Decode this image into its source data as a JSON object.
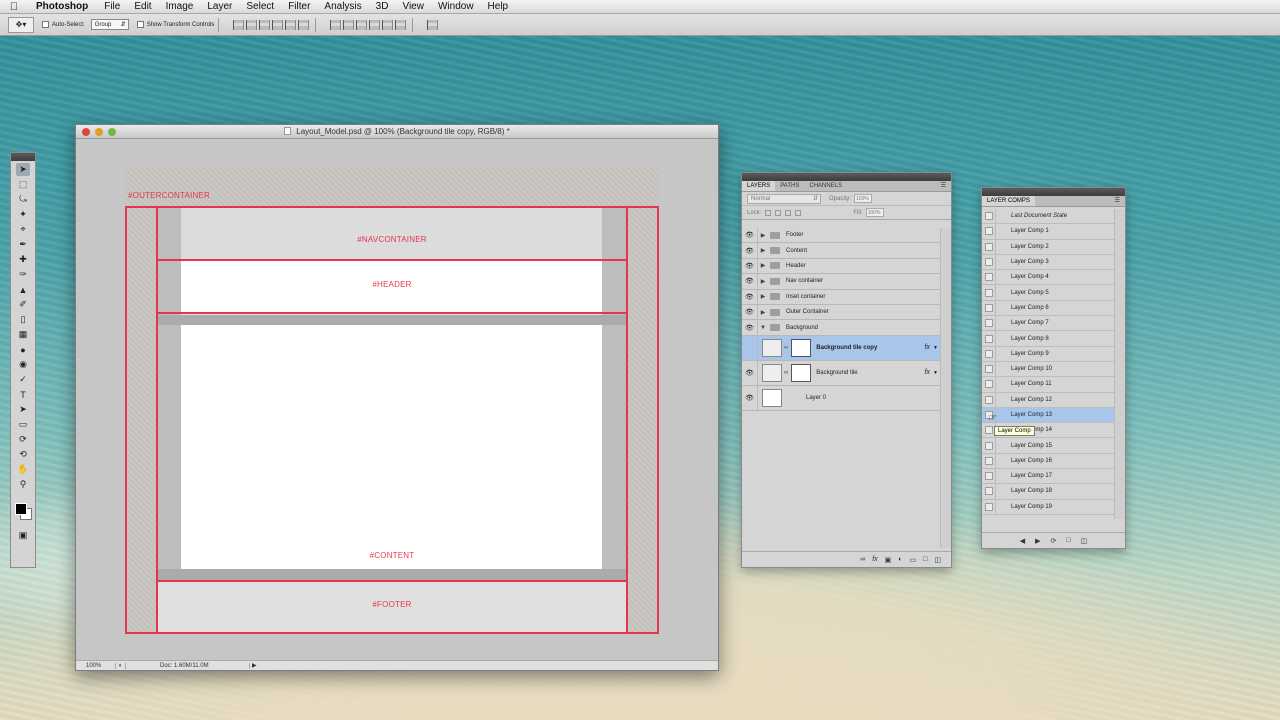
{
  "menubar": {
    "app_name": "Photoshop",
    "menus": [
      "File",
      "Edit",
      "Image",
      "Layer",
      "Select",
      "Filter",
      "Analysis",
      "3D",
      "View",
      "Window",
      "Help"
    ]
  },
  "options": {
    "auto_select_label": "Auto-Select:",
    "group_value": "Group",
    "transform_label": "Show Transform Controls"
  },
  "document": {
    "title": "Layout_Model.psd @ 100% (Background tile copy, RGB/8) *",
    "zoom": "100%",
    "doc_info": "Doc: 1.60M/11.0M",
    "labels": {
      "outer": "#OUTERCONTAINER",
      "nav": "#NAVCONTAINER",
      "header": "#HEADER",
      "content": "#CONTENT",
      "footer": "#FOOTER"
    }
  },
  "layers_panel": {
    "tabs": [
      "LAYERS",
      "PATHS",
      "CHANNELS"
    ],
    "blend_mode": "Normal",
    "opacity_label": "Opacity:",
    "opacity_value": "100%",
    "lock_label": "Lock:",
    "fill_label": "Fill:",
    "fill_value": "100%",
    "layers": [
      {
        "name": "Footer",
        "type": "group",
        "visible": true
      },
      {
        "name": "Content",
        "type": "group",
        "visible": true
      },
      {
        "name": "Header",
        "type": "group",
        "visible": true
      },
      {
        "name": "Nav container",
        "type": "group",
        "visible": true
      },
      {
        "name": "Inset container",
        "type": "group",
        "visible": true
      },
      {
        "name": "Outer Container",
        "type": "group",
        "visible": true
      },
      {
        "name": "Background",
        "type": "group-open",
        "visible": true
      },
      {
        "name": "Background tile copy",
        "type": "layer-fx",
        "visible": false,
        "selected": true
      },
      {
        "name": "Background tile",
        "type": "layer-fx",
        "visible": true
      },
      {
        "name": "Layer 0",
        "type": "layer",
        "visible": true
      }
    ],
    "fx_label": "fx"
  },
  "comps_panel": {
    "tab": "LAYER COMPS",
    "items": [
      "Last Document State",
      "Layer Comp 1",
      "Layer Comp 2",
      "Layer Comp 3",
      "Layer Comp 4",
      "Layer Comp 5",
      "Layer Comp 6",
      "Layer Comp 7",
      "Layer Comp 8",
      "Layer Comp 9",
      "Layer Comp 10",
      "Layer Comp 11",
      "Layer Comp 12",
      "Layer Comp 13",
      "Layer Comp 14",
      "Layer Comp 15",
      "Layer Comp 16",
      "Layer Comp 17",
      "Layer Comp 18",
      "Layer Comp 19"
    ],
    "selected_index": 13,
    "tooltip": "Layer Comp"
  }
}
